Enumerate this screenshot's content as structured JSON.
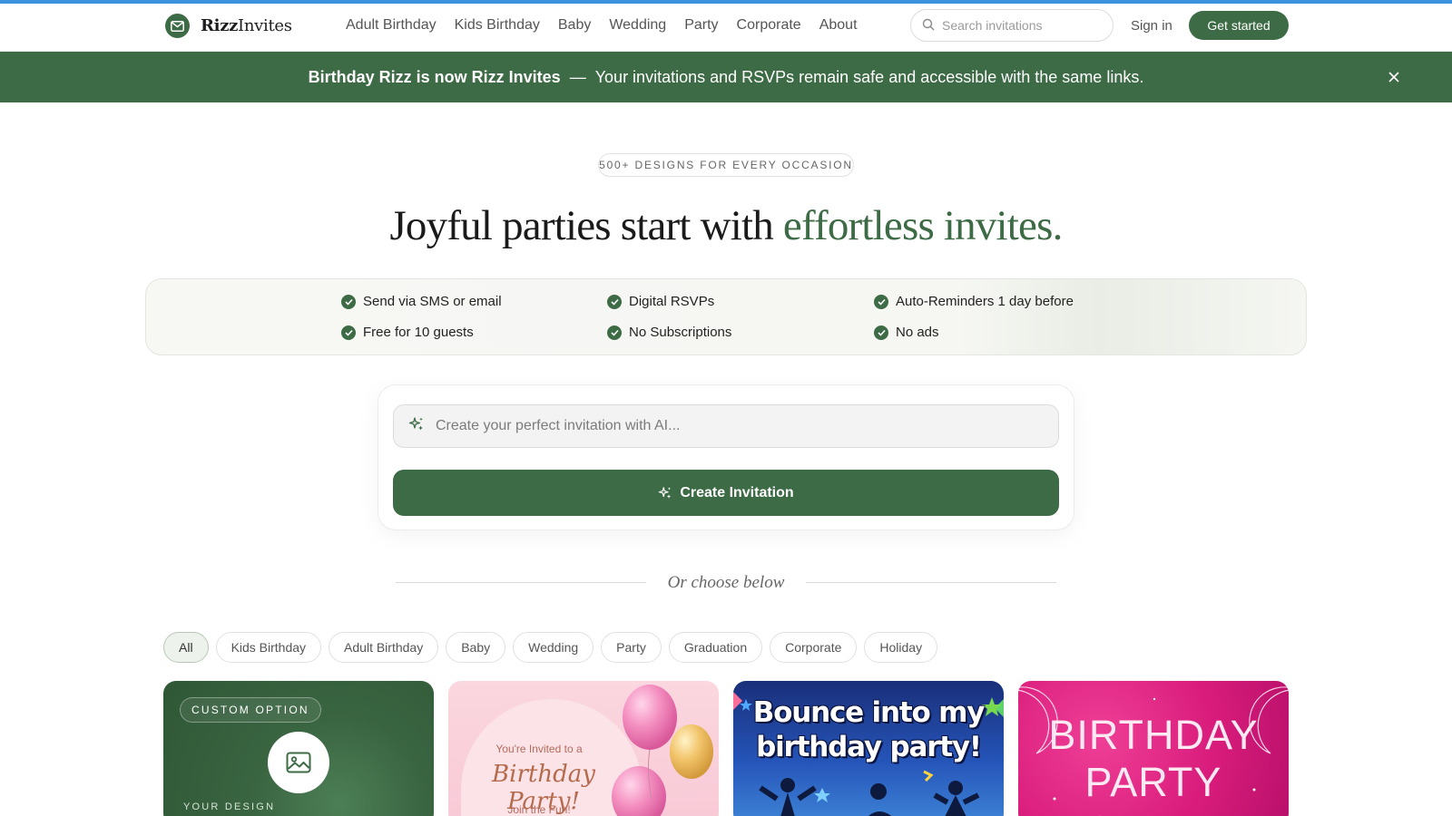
{
  "header": {
    "brand_bold": "Rizz",
    "brand_rest": "Invites",
    "nav": [
      "Adult Birthday",
      "Kids Birthday",
      "Baby",
      "Wedding",
      "Party",
      "Corporate",
      "About"
    ],
    "search_placeholder": "Search invitations",
    "signin_label": "Sign in",
    "cta_label": "Get started"
  },
  "banner": {
    "bold_text": "Birthday Rizz is now Rizz Invites",
    "separator": "—",
    "text": "Your invitations and RSVPs remain safe and accessible with the same links."
  },
  "hero": {
    "tag": "500+ DESIGNS FOR EVERY OCCASION",
    "headline_main": "Joyful parties start with ",
    "headline_accent": "effortless invites."
  },
  "features": [
    "Send via SMS or email",
    "Digital RSVPs",
    "Auto-Reminders 1 day before",
    "Free for 10 guests",
    "No Subscriptions",
    "No ads"
  ],
  "ai": {
    "placeholder": "Create your perfect invitation with AI...",
    "button_label": "Create Invitation"
  },
  "divider_text": "Or choose below",
  "categories": [
    "All",
    "Kids Birthday",
    "Adult Birthday",
    "Baby",
    "Wedding",
    "Party",
    "Graduation",
    "Corporate",
    "Holiday"
  ],
  "active_category": "All",
  "cards": {
    "custom": {
      "tag": "CUSTOM OPTION",
      "label": "YOUR DESIGN"
    },
    "balloon": {
      "line1": "You're Invited to a",
      "line2": "Birthday Party!",
      "line3": "Join the Fun!"
    },
    "bounce": {
      "title_line1": "Bounce into my",
      "title_line2": "birthday party!"
    },
    "glitter": {
      "title_line1": "BIRTHDAY",
      "title_line2": "PARTY"
    }
  },
  "colors": {
    "brand_green": "#3d6b45",
    "top_accent": "#3b93dc"
  }
}
